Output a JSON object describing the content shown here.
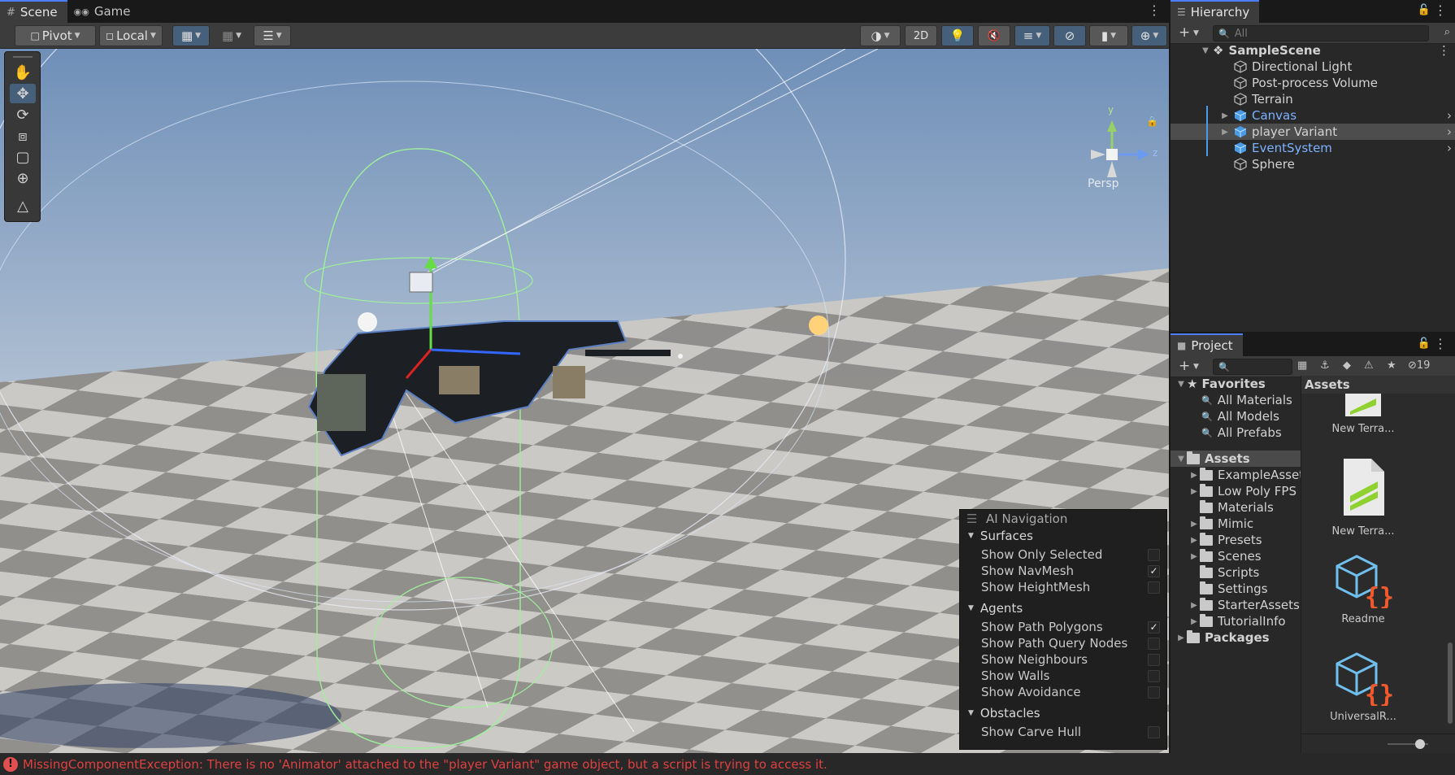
{
  "scene_panel": {
    "tabs": [
      {
        "label": "Scene",
        "icon": "grid-icon"
      },
      {
        "label": "Game",
        "icon": "gamepad-icon"
      }
    ],
    "toolbar": {
      "pivot": "Pivot",
      "local": "Local",
      "mode_2d": "2D"
    },
    "gizmo": {
      "y": "y",
      "z": "z",
      "projection": "Persp"
    },
    "ai_navigation": {
      "title": "AI Navigation",
      "sections": [
        {
          "label": "Surfaces",
          "items": [
            {
              "label": "Show Only Selected",
              "checked": false
            },
            {
              "label": "Show NavMesh",
              "checked": true
            },
            {
              "label": "Show HeightMesh",
              "checked": false
            }
          ]
        },
        {
          "label": "Agents",
          "items": [
            {
              "label": "Show Path Polygons",
              "checked": true
            },
            {
              "label": "Show Path Query Nodes",
              "checked": false
            },
            {
              "label": "Show Neighbours",
              "checked": false
            },
            {
              "label": "Show Walls",
              "checked": false
            },
            {
              "label": "Show Avoidance",
              "checked": false
            }
          ]
        },
        {
          "label": "Obstacles",
          "items": [
            {
              "label": "Show Carve Hull",
              "checked": false
            }
          ]
        }
      ]
    }
  },
  "hierarchy": {
    "title": "Hierarchy",
    "search_placeholder": "All",
    "scene": "SampleScene",
    "items": [
      {
        "label": "Directional Light",
        "prefab": false,
        "expandable": false
      },
      {
        "label": "Post-process Volume",
        "prefab": false,
        "expandable": false
      },
      {
        "label": "Terrain",
        "prefab": false,
        "expandable": false
      },
      {
        "label": "Canvas",
        "prefab": true,
        "expandable": true
      },
      {
        "label": "player Variant",
        "prefab": true,
        "expandable": true,
        "selected": true
      },
      {
        "label": "EventSystem",
        "prefab": true,
        "expandable": false
      },
      {
        "label": "Sphere",
        "prefab": false,
        "expandable": false
      }
    ]
  },
  "project": {
    "title": "Project",
    "hidden_count": "19",
    "favorites": {
      "label": "Favorites",
      "items": [
        "All Materials",
        "All Models",
        "All Prefabs"
      ]
    },
    "assets": {
      "label": "Assets",
      "folders": [
        {
          "label": "ExampleAssets",
          "expandable": true
        },
        {
          "label": "Low Poly FPS",
          "expandable": true
        },
        {
          "label": "Materials",
          "expandable": false
        },
        {
          "label": "Mimic",
          "expandable": true
        },
        {
          "label": "Presets",
          "expandable": true
        },
        {
          "label": "Scenes",
          "expandable": true
        },
        {
          "label": "Scripts",
          "expandable": false
        },
        {
          "label": "Settings",
          "expandable": false
        },
        {
          "label": "StarterAssets",
          "expandable": true
        },
        {
          "label": "TutorialInfo",
          "expandable": true
        }
      ]
    },
    "packages": "Packages",
    "grid_header": "Assets",
    "grid_items": [
      {
        "label": "New Terra...",
        "icon": "terrain-data-icon"
      },
      {
        "label": "New Terra...",
        "icon": "terrain-data-icon"
      },
      {
        "label": "Readme",
        "icon": "script-asset-icon"
      },
      {
        "label": "UniversalR...",
        "icon": "script-asset-icon"
      }
    ]
  },
  "console": {
    "error": "MissingComponentException: There is no 'Animator' attached to the \"player Variant\" game object, but a script is trying to access it."
  },
  "colors": {
    "accent": "#4c7fff",
    "selection": "#46607c",
    "error": "#e04040",
    "prefab": "#7cb2ff"
  }
}
